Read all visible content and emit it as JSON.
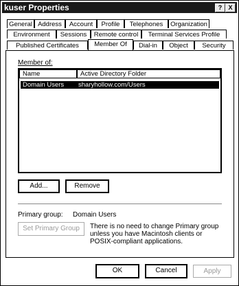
{
  "window": {
    "title": "kuser Properties",
    "help_btn": "?",
    "close_btn": "X"
  },
  "tabs_row1": [
    "General",
    "Address",
    "Account",
    "Profile",
    "Telephones",
    "Organization"
  ],
  "tabs_row2": [
    "Environment",
    "Sessions",
    "Remote control",
    "Terminal Services Profile"
  ],
  "tabs_row3": [
    "Published Certificates",
    "Member Of",
    "Dial-in",
    "Object",
    "Security"
  ],
  "member_of": {
    "label": "Member of:",
    "col_name": "Name",
    "col_folder": "Active Directory Folder",
    "rows": [
      {
        "name": "Domain Users",
        "folder": "sharyhollow.com/Users"
      }
    ],
    "add_button": "Add...",
    "remove_button": "Remove"
  },
  "primary": {
    "label": "Primary group:",
    "value": "Domain Users",
    "set_button": "Set Primary Group",
    "note": "There is no need to change Primary group unless you have Macintosh clients or POSIX-compliant applications."
  },
  "footer": {
    "ok": "OK",
    "cancel": "Cancel",
    "apply": "Apply"
  }
}
